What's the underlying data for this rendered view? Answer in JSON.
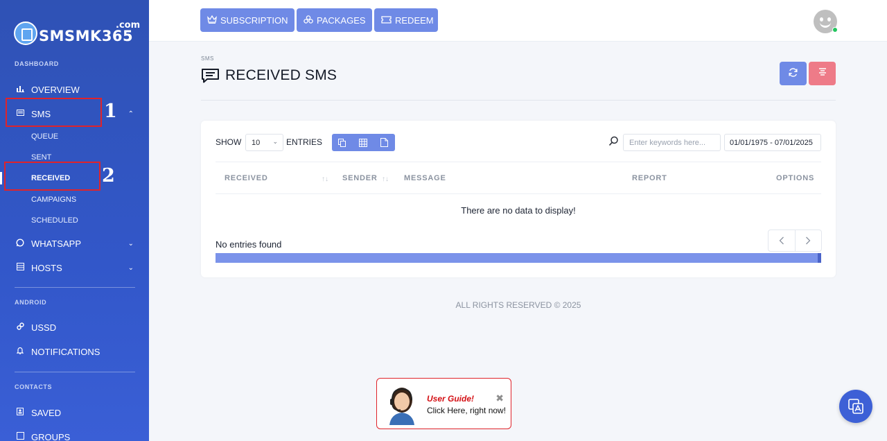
{
  "brand": {
    "name": "SMSMK365",
    "suffix": ".com"
  },
  "sidebar": {
    "sections": {
      "dashboard": "DASHBOARD",
      "android": "ANDROID",
      "contacts": "CONTACTS"
    },
    "items": {
      "overview": "OVERVIEW",
      "sms": "SMS",
      "whatsapp": "WHATSAPP",
      "hosts": "HOSTS",
      "ussd": "USSD",
      "notifications": "NOTIFICATIONS",
      "saved": "SAVED",
      "groups": "GROUPS"
    },
    "sms_sub": {
      "queue": "QUEUE",
      "sent": "SENT",
      "received": "RECEIVED",
      "campaigns": "CAMPAIGNS",
      "scheduled": "SCHEDULED"
    },
    "annotations": {
      "one": "1",
      "two": "2"
    }
  },
  "topbar": {
    "subscription": "SUBSCRIPTION",
    "packages": "PACKAGES",
    "redeem": "REDEEM"
  },
  "page": {
    "breadcrumb": "SMS",
    "title": "RECEIVED SMS"
  },
  "table": {
    "show_label": "SHOW",
    "entries_value": "10",
    "entries_label": "ENTRIES",
    "search_placeholder": "Enter keywords here...",
    "date_range": "01/01/1975 - 07/01/2025",
    "columns": {
      "received": "RECEIVED",
      "sender": "SENDER",
      "message": "MESSAGE",
      "report": "REPORT",
      "options": "OPTIONS"
    },
    "empty_message": "There are no data to display!",
    "status": "No entries found"
  },
  "footer": "ALL RIGHTS RESERVED © 2025",
  "guide": {
    "title": "User Guide!",
    "subtitle": "Click Here, right now!"
  },
  "colors": {
    "sidebar": "#3257c9",
    "primary_button": "#6f8ae6",
    "danger_button": "#ee7b88",
    "annotation": "#e0232a"
  }
}
